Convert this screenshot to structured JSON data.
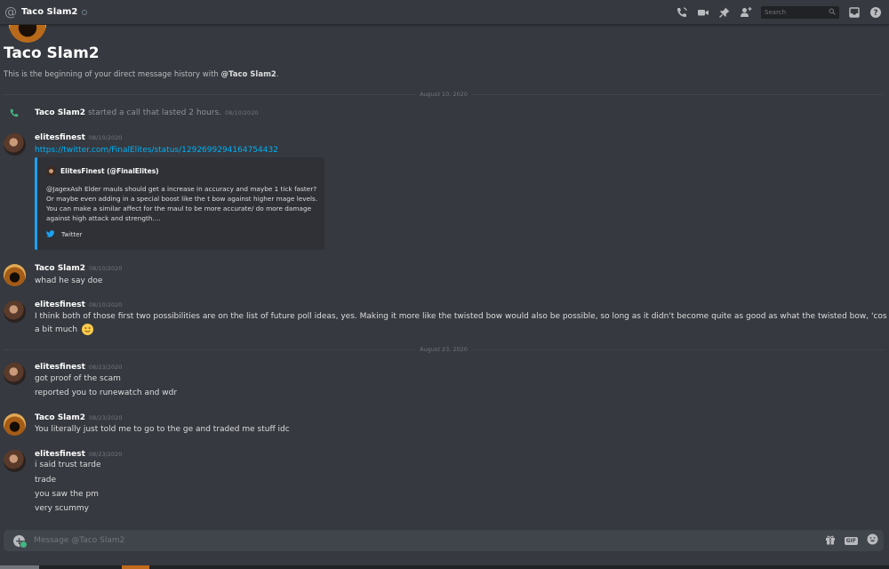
{
  "channel": {
    "title": "Taco Slam2"
  },
  "search": {
    "placeholder": "Search"
  },
  "intro": {
    "title": "Taco Slam2",
    "subtitle_prefix": "This is the beginning of your direct message history with ",
    "subtitle_mention": "@Taco Slam2",
    "subtitle_suffix": "."
  },
  "dividers": [
    "August 10, 2020",
    "August 23, 2020"
  ],
  "call": {
    "name": "Taco Slam2",
    "text": "started a call that lasted 2 hours.",
    "timestamp": "08/10/2020"
  },
  "messages": [
    {
      "author": "elitesfinest",
      "timestamp": "08/10/2020",
      "link": "https://twitter.com/FinalElites/status/1292699294164754432"
    },
    {
      "author": "Taco Slam2",
      "timestamp": "08/10/2020",
      "lines": [
        "whad he say doe"
      ]
    },
    {
      "author": "elitesfinest",
      "timestamp": "08/10/2020",
      "lines": [
        "I think both of those first two possibilities are on the list of future poll ideas, yes. Making it more like the twisted bow would also be possible, so long as it didn't become quite as good as what the twisted bow, 'cos that one's",
        "a bit much"
      ]
    },
    {
      "author": "elitesfinest",
      "timestamp": "08/23/2020",
      "lines": [
        "got proof of the scam",
        "reported you to runewatch and wdr"
      ]
    },
    {
      "author": "Taco Slam2",
      "timestamp": "08/23/2020",
      "lines": [
        "You literally just told me to go to the ge and traded me stuff idc"
      ]
    },
    {
      "author": "elitesfinest",
      "timestamp": "08/23/2020",
      "lines": [
        "i said trust tarde",
        "trade",
        "you saw the pm",
        "very scummy"
      ]
    }
  ],
  "embed": {
    "author": "ElitesFinest (@FinalElites)",
    "description": "@JagexAsh Elder mauls should get a increase in accuracy and maybe 1 tick faster? Or maybe even adding in a special boost like the t bow against higher mage levels. You can make a similar affect for the maul to be more accurate/ do more damage against high attack and strength....",
    "footer": "Twitter",
    "accent_color": "#1da1f2"
  },
  "composer": {
    "placeholder": "Message @Taco Slam2",
    "gif_label": "GIF"
  },
  "icons": [
    "at-icon",
    "phone-call-icon",
    "video-icon",
    "pin-icon",
    "add-friend-icon",
    "search-icon",
    "inbox-icon",
    "help-icon",
    "phone-icon",
    "twitter-bird-icon",
    "add-attachment-icon",
    "gift-icon",
    "gif-icon",
    "emoji-icon"
  ],
  "colors": {
    "background": "#36393f",
    "link": "#00b0f4",
    "input": "#40444b",
    "call_green": "#43b581"
  }
}
